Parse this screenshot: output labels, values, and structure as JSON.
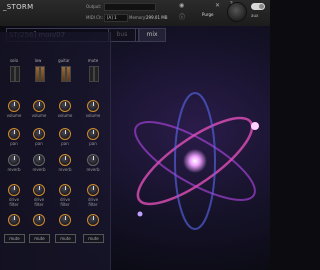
{
  "header": {
    "title": "_STORM",
    "output_label": "Output:",
    "midi_label": "MIDI Ch:",
    "memory_label": "Memory:",
    "midi_value": "[A] 1",
    "memory_value": "299.01 MB",
    "purge_label": "Purge",
    "tune_label": "Tune",
    "aux_label": "aux"
  },
  "panel": {
    "path": "ST/256] mon/07",
    "tab_bus": "bus",
    "tab_mix": "mix",
    "channels": [
      {
        "name": "solo",
        "on": false
      },
      {
        "name": "low",
        "on": true
      },
      {
        "name": "guitar",
        "on": true
      },
      {
        "name": "mute",
        "on": false
      }
    ],
    "knob_labels": {
      "volume": "volume",
      "pan": "pan",
      "reverb": "reverb",
      "drive": "drive filter",
      "mute": "mute"
    }
  },
  "colors": {
    "accent": "#d08a2a",
    "atom": "#d24fc9"
  }
}
